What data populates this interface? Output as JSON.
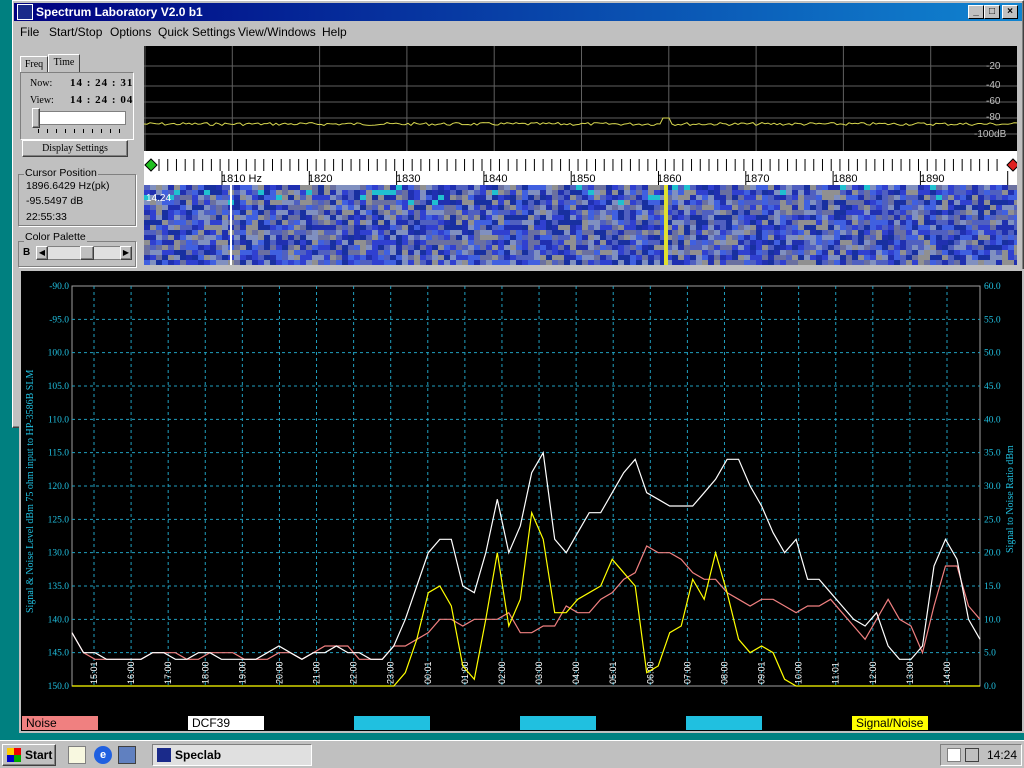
{
  "app": {
    "title": "Spectrum Laboratory V2.0 b1"
  },
  "menu": [
    "File",
    "Start/Stop",
    "Options",
    "Quick Settings",
    "View/Windows",
    "Help"
  ],
  "left_panel": {
    "tabs": [
      "Freq",
      "Time"
    ],
    "now_label": "Now:",
    "now_value": "14 : 24 : 31",
    "view_label": "View:",
    "view_value": "14 : 24 : 04",
    "display_settings_label": "Display Settings",
    "cursor_title": "Cursor Position",
    "cursor_freq": "1896.6429 Hz(pk)",
    "cursor_level": "-95.5497 dB",
    "cursor_time": "22:55:33",
    "palette_title": "Color Palette",
    "palette_b": "B"
  },
  "spectrum": {
    "db_labels": [
      "-20",
      "-40",
      "-60",
      "-80",
      "-100dB"
    ],
    "trace_color": "#d8d850"
  },
  "freq_scale": {
    "labels": [
      "1810 Hz",
      "1820",
      "1830",
      "1840",
      "1850",
      "1860",
      "1870",
      "1880",
      "1890"
    ]
  },
  "waterfall": {
    "time_label": "14.24"
  },
  "chart_data": {
    "type": "line",
    "ylabel": "Signal & Noise Level  dBm 75 ohm input to HP-3586B SLM",
    "y2label": "Signal to Noise Ratio   dBm",
    "ylim": [
      -150,
      -90
    ],
    "y2lim": [
      0,
      60
    ],
    "yticks": [
      "-90.0",
      "-95.0",
      "100.0",
      "105.0",
      "110.0",
      "115.0",
      "120.0",
      "125.0",
      "130.0",
      "135.0",
      "140.0",
      "145.0",
      "150.0"
    ],
    "y2ticks": [
      "60.0",
      "55.0",
      "50.0",
      "45.0",
      "40.0",
      "35.0",
      "30.0",
      "25.0",
      "20.0",
      "15.0",
      "10.0",
      "5.0",
      "0.0"
    ],
    "xticks": [
      "15:01",
      "16:00",
      "17:00",
      "18:00",
      "19:00",
      "20:00",
      "21:00",
      "22:00",
      "23:00",
      "00:01",
      "01:00",
      "02:00",
      "03:00",
      "04:00",
      "05:01",
      "06:00",
      "07:00",
      "08:00",
      "09:01",
      "10:00",
      "11:01",
      "12:00",
      "13:00",
      "14:00"
    ],
    "grid": true,
    "series": [
      {
        "name": "Noise",
        "color": "#f08080",
        "values": [
          -142,
          -145,
          -146,
          -146,
          -146,
          -146,
          -146,
          -145,
          -145,
          -145,
          -146,
          -146,
          -145,
          -145,
          -145,
          -146,
          -146,
          -146,
          -145,
          -145,
          -146,
          -145,
          -144,
          -144,
          -144,
          -146,
          -146,
          -146,
          -144,
          -144,
          -143,
          -142,
          -140,
          -140,
          -141,
          -140,
          -140,
          -140,
          -139,
          -142,
          -142,
          -141,
          -141,
          -138,
          -139,
          -139,
          -137,
          -136,
          -134,
          -133,
          -129,
          -130,
          -130,
          -131,
          -133,
          -134,
          -134,
          -136,
          -137,
          -138,
          -137,
          -137,
          -138,
          -139,
          -138,
          -138,
          -137,
          -139,
          -141,
          -143,
          -140,
          -137,
          -140,
          -141,
          -145,
          -138,
          -132,
          -132,
          -138,
          -140
        ]
      },
      {
        "name": "DCF39",
        "color": "#ffffff",
        "values": [
          -142,
          -145,
          -145,
          -146,
          -146,
          -146,
          -146,
          -145,
          -145,
          -146,
          -146,
          -145,
          -145,
          -146,
          -146,
          -146,
          -146,
          -145,
          -144,
          -145,
          -146,
          -145,
          -145,
          -144,
          -145,
          -145,
          -146,
          -146,
          -144,
          -140,
          -135,
          -130,
          -128,
          -128,
          -135,
          -136,
          -130,
          -122,
          -130,
          -126,
          -118,
          -115,
          -128,
          -130,
          -127,
          -124,
          -124,
          -121,
          -118,
          -116,
          -121,
          -122,
          -123,
          -123,
          -123,
          -121,
          -119,
          -116,
          -116,
          -120,
          -123,
          -127,
          -130,
          -128,
          -134,
          -134,
          -136,
          -138,
          -140,
          -141,
          -139,
          -144,
          -146,
          -146,
          -144,
          -132,
          -128,
          -131,
          -140,
          -143
        ]
      },
      {
        "name": "Signal/Noise",
        "color": "#ffff00",
        "values": [
          0,
          0,
          0,
          0,
          0,
          0,
          0,
          0,
          0,
          0,
          0,
          0,
          0,
          0,
          0,
          0,
          0,
          0,
          0,
          0,
          0,
          0,
          0,
          0,
          0,
          0,
          0,
          0,
          0,
          2,
          7,
          14,
          15,
          12,
          3,
          1,
          10,
          20,
          9,
          13,
          26,
          22,
          11,
          11,
          13,
          14,
          15,
          19,
          17,
          15,
          2,
          3,
          8,
          9,
          16,
          13,
          20,
          14,
          7,
          5,
          6,
          5,
          1,
          0,
          0,
          0,
          0,
          0,
          0,
          0,
          0,
          0,
          0,
          0,
          0,
          0,
          0,
          0,
          0,
          0
        ]
      }
    ],
    "legend_extra_color": "#20c0e0"
  },
  "legend": {
    "noise": "Noise",
    "dcf39": "DCF39",
    "snr": "Signal/Noise"
  },
  "taskbar": {
    "start_label": "Start",
    "task_label": "Speclab",
    "clock": "14:24"
  }
}
